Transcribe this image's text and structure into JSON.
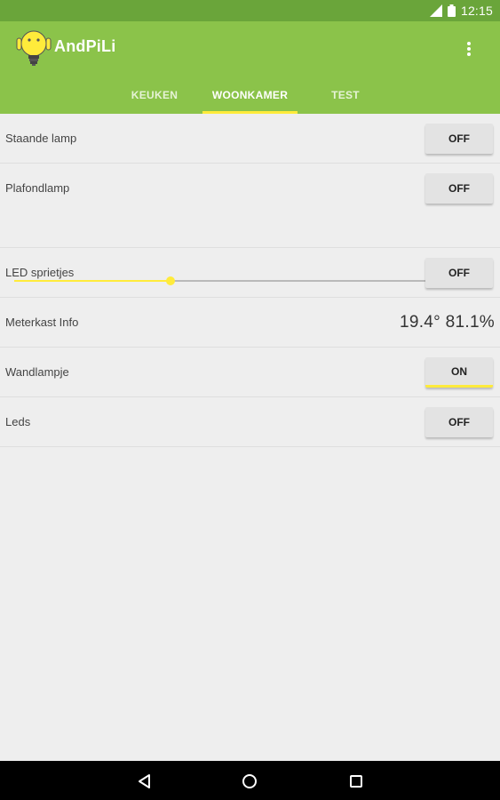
{
  "status_bar": {
    "time": "12:15",
    "icons": [
      "signal-icon",
      "battery-icon"
    ]
  },
  "app_bar": {
    "title": "AndPiLi",
    "logo_icon": "lightbulb-robot-icon",
    "menu_icon": "overflow-menu-icon"
  },
  "tabs": [
    {
      "label": "KEUKEN",
      "active": false
    },
    {
      "label": "WOONKAMER",
      "active": true
    },
    {
      "label": "TEST",
      "active": false
    }
  ],
  "rows": [
    {
      "label": "Staande lamp",
      "button": "OFF"
    },
    {
      "label": "Plafondlamp",
      "button": "OFF",
      "slider_level": 0.33
    },
    {
      "label": "LED sprietjes",
      "button": "OFF"
    },
    {
      "label": "Meterkast Info",
      "value": "19.4° 81.1%"
    },
    {
      "label": "Wandlampje",
      "button": "ON"
    },
    {
      "label": "Leds",
      "button": "OFF"
    }
  ],
  "colors": {
    "primary": "#8bc34a",
    "primary_dark": "#6aa53a",
    "accent": "#ffeb3b",
    "background": "#eeeeee"
  },
  "nav_bar": {
    "icons": [
      "back-icon",
      "home-icon",
      "recent-apps-icon"
    ]
  }
}
